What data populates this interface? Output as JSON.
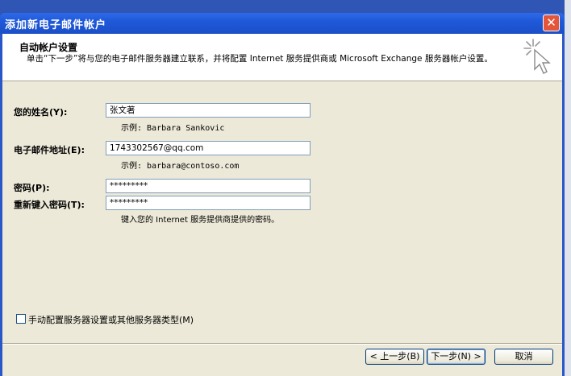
{
  "window": {
    "title": "添加新电子邮件帐户",
    "close_label": "✕"
  },
  "header": {
    "title": "自动帐户设置",
    "description": "单击“下一步”将与您的电子邮件服务器建立联系，并将配置 Internet 服务提供商或 Microsoft Exchange 服务器帐户设置。"
  },
  "form": {
    "name_label": "您的姓名(Y):",
    "name_value": "张文著",
    "name_example": "示例: Barbara Sankovic",
    "email_label": "电子邮件地址(E):",
    "email_value": "1743302567@qq.com",
    "email_example": "示例: barbara@contoso.com",
    "password_label": "密码(P):",
    "password_value": "*********",
    "retype_label": "重新键入密码(T):",
    "retype_value": "*********",
    "password_hint": "键入您的 Internet 服务提供商提供的密码。"
  },
  "manual_config": {
    "label": "手动配置服务器设置或其他服务器类型(M)",
    "checked": false
  },
  "buttons": {
    "back": "< 上一步(B)",
    "next": "下一步(N) >",
    "cancel": "取消"
  },
  "colors": {
    "title_bar": "#1f58d8",
    "dialog_bg": "#ece9d8",
    "header_bg": "#ffffff",
    "close_button": "#e4553a"
  }
}
